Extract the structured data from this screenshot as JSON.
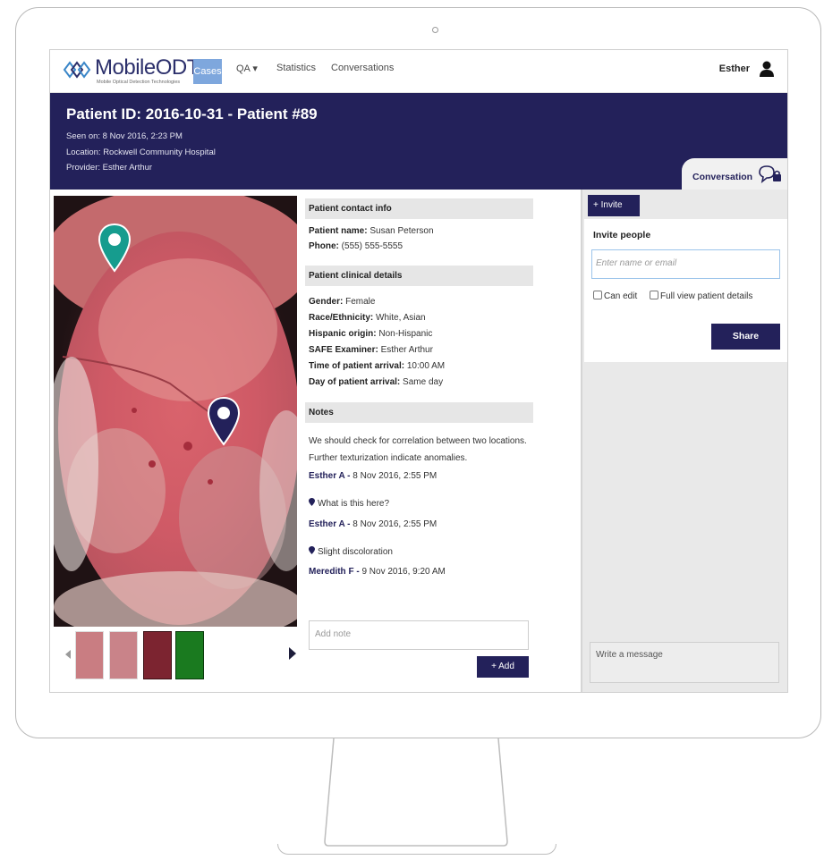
{
  "nav": {
    "logo_text": "MobileODT",
    "logo_subtext": "Mobile Optical Detection Technologies",
    "items": [
      "Cases",
      "QA ▾",
      "Statistics",
      "Conversations"
    ],
    "user": "Esther"
  },
  "patient": {
    "title": "Patient ID: 2016-10-31 - Patient #89",
    "seen_on": "Seen on: 8 Nov 2016, 2:23 PM",
    "location": "Location: Rockwell Community Hospital",
    "provider": "Provider: Esther Arthur"
  },
  "conversation_tab": {
    "label": "Conversation"
  },
  "contact": {
    "heading": "Patient contact info",
    "name_label": "Patient name:",
    "name_value": "Susan Peterson",
    "phone_label": "Phone:",
    "phone_value": "(555) 555-5555"
  },
  "clinical": {
    "heading": "Patient clinical details",
    "rows": [
      {
        "label": "Gender:",
        "value": "Female"
      },
      {
        "label": "Race/Ethnicity:",
        "value": "White, Asian"
      },
      {
        "label": "Hispanic origin:",
        "value": "Non-Hispanic"
      },
      {
        "label": "SAFE Examiner:",
        "value": "Esther Arthur"
      },
      {
        "label": "Time of patient arrival:",
        "value": "10:00 AM"
      },
      {
        "label": "Day of patient arrival:",
        "value": "Same day"
      }
    ]
  },
  "notes": {
    "heading": "Notes",
    "note1_line1": "We should check for correlation between two locations.",
    "note1_line2": "Further texturization indicate anomalies.",
    "note1_author": "Esther A -",
    "note1_time": "8 Nov 2016, 2:55 PM",
    "note2_text": "What is this here?",
    "note2_author": "Esther A -",
    "note2_time": "8 Nov 2016, 2:55 PM",
    "note3_text": "Slight discoloration",
    "note3_author": "Meredith F -",
    "note3_time": "9 Nov 2016, 9:20 AM",
    "add_placeholder": "Add note",
    "add_button": "+ Add"
  },
  "invite": {
    "tab_label": "+ Invite",
    "title": "Invite people",
    "input_placeholder": "Enter name or email",
    "can_edit": "Can edit",
    "full_view": "Full view patient details",
    "share_button": "Share",
    "message_placeholder": "Write a message"
  },
  "colors": {
    "navy": "#23215a",
    "accent_blue": "#7ea7dd",
    "pin_teal": "#169c8e"
  }
}
